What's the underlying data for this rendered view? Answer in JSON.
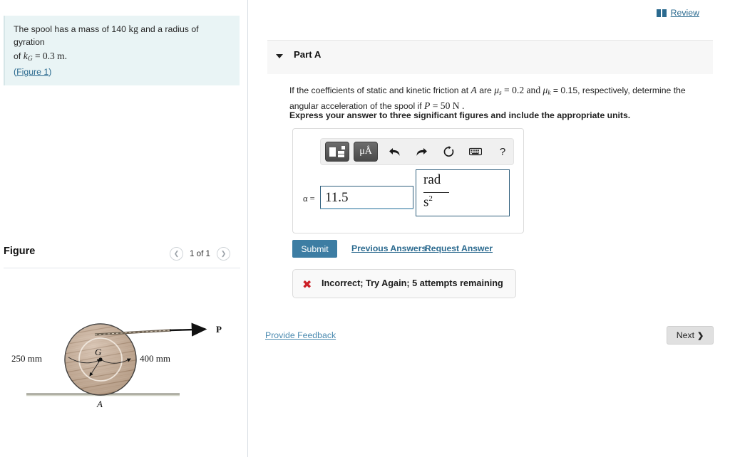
{
  "sidebar": {
    "problem": {
      "line1_pre": "The spool has a mass of 140 ",
      "line1_unit": "kg",
      "line1_post": " and a radius of gyration",
      "line2_pre": "of ",
      "line2_sym": "k",
      "line2_sub": "G",
      "line2_eq": " = 0.3 m.",
      "figure_link_open": "(",
      "figure_link": "Figure 1",
      "figure_link_close": ")"
    },
    "figure_header": {
      "title": "Figure",
      "prev_icon": "chevron-left-icon",
      "pager_label": "1 of 1",
      "next_icon": "chevron-right-icon"
    },
    "figure": {
      "label_left": "250 mm",
      "label_right": "400 mm",
      "label_center": "G",
      "label_contact": "A",
      "label_force": "P"
    }
  },
  "review": {
    "icon": "book-icon",
    "label": "Review"
  },
  "part": {
    "caret_icon": "caret-down-icon",
    "title": "Part A",
    "question": {
      "seg1": "If the coefficients of static and kinetic friction at ",
      "var_A": "A",
      "seg2": " are ",
      "mu_s": "μ",
      "mu_s_sub": "s",
      "seg3": " = 0.2 and ",
      "mu_k": "μ",
      "mu_k_sub": "k",
      "seg4": " = 0.15, respectively, determine the angular acceleration of the spool if ",
      "var_P": "P",
      "seg5": " = 50 N ."
    },
    "instruction": "Express your answer to three significant figures and include the appropriate units."
  },
  "answer": {
    "toolbar": {
      "template_icon": "math-template-icon",
      "units_icon": "greek-units-icon",
      "units_label": "μÅ",
      "undo_icon": "undo-arrow-icon",
      "redo_icon": "redo-arrow-icon",
      "reset_icon": "reset-circular-arrow-icon",
      "keyboard_icon": "keyboard-icon",
      "help_icon": "help-question-icon",
      "help_label": "?"
    },
    "variable_label": "α =",
    "value": "11.5",
    "unit_numerator": "rad",
    "unit_denominator": "s",
    "unit_denominator_exp": "2"
  },
  "actions": {
    "submit_label": "Submit",
    "previous_answers_label": "Previous Answers",
    "request_answer_label": "Request Answer"
  },
  "feedback": {
    "status_icon": "x-mark-icon",
    "status_glyph": "✖",
    "message": "Incorrect; Try Again; 5 attempts remaining"
  },
  "footer": {
    "provide_feedback_label": "Provide Feedback",
    "next_label": "Next",
    "next_chevron": "❯"
  },
  "colors": {
    "accent_blue": "#2b6a8f",
    "submit_blue": "#3d7da3",
    "error_red": "#cc2027",
    "problem_bg": "#e9f4f5",
    "panel_bg": "#f7f7f7",
    "field_border": "#2f5f7d",
    "spool_wood": "#c9b09a"
  }
}
